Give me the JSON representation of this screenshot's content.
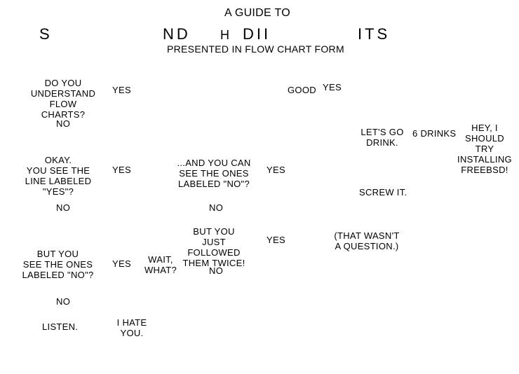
{
  "title": {
    "line1": "A GUIDE TO",
    "line2_fragments": [
      "S",
      "ND",
      "H",
      "DII",
      "ITS"
    ],
    "line3": "PRESENTED IN FLOW CHART FORM"
  },
  "nodes": {
    "q_understand": "DO YOU\nUNDERSTAND\nFLOW CHARTS?",
    "understand_yes": "YES",
    "understand_no": "NO",
    "good": "GOOD",
    "good_yes": "YES",
    "lets_drink": "LET'S GO\nDRINK.",
    "six_drinks": "6 DRINKS",
    "freebsd": "HEY, I SHOULD\nTRY INSTALLING\nFREEBSD!",
    "okay_line_yes": "OKAY.\nYOU SEE THE\nLINE LABELED\n\"YES\"?",
    "okay_yes": "YES",
    "okay_no": "NO",
    "and_no": "...AND YOU CAN\nSEE THE ONES\nLABELED \"NO\"?",
    "and_no_yes": "YES",
    "and_no_no": "NO",
    "screw_it": "SCREW IT.",
    "but_followed": "BUT YOU\nJUST FOLLOWED\nTHEM TWICE!",
    "followed_yes": "YES",
    "followed_no": "NO",
    "not_question": "(THAT WASN'T\nA QUESTION.)",
    "but_see_no": "BUT YOU\nSEE THE ONES\nLABELED \"NO\"?",
    "see_no_yes": "YES",
    "see_no_no": "NO",
    "wait_what": "WAIT,\nWHAT?",
    "listen": "LISTEN.",
    "hate_you": "I HATE\nYOU."
  }
}
